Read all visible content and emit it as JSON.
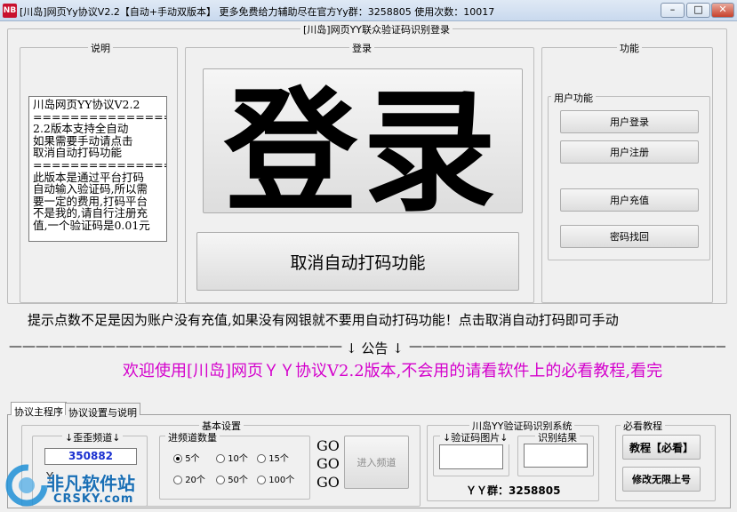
{
  "window": {
    "icon_text": "NB",
    "title": "[川岛]网页Yy协议V2.2【自动+手动双版本】   更多免费给力辅助尽在官方Yy群：3258805   使用次数：10017",
    "min": "–",
    "max": "□",
    "close": "✕"
  },
  "main_group": {
    "label": "[川岛]网页YY联众验证码识别登录"
  },
  "explain": {
    "label": "说明",
    "lines": [
      " 川岛网页YY协议V2.2",
      "======================",
      "2.2版本支持全自动",
      "如果需要手动请点击",
      "取消自动打码功能",
      "======================",
      "此版本是通过平台打码",
      "自动输入验证码,所以需",
      "要一定的费用,打码平台",
      "不是我的,请自行注册充",
      "值,一个验证码是0.01元"
    ]
  },
  "login": {
    "label": "登录",
    "big_button": "登录",
    "cancel_auto": "取消自动打码功能"
  },
  "features": {
    "label": "功能",
    "user_group": "用户功能",
    "buttons": [
      "用户登录",
      "用户注册",
      "用户充值",
      "密码找回"
    ]
  },
  "hint": "提示点数不足是因为账户没有充值,如果没有网银就不要用自动打码功能！点击取消自动打码即可手动",
  "notice": {
    "left": "——————————————————————————",
    "title": "↓ 公告 ↓",
    "right": "——————————————————————————"
  },
  "marquee": "欢迎使用[川岛]网页ＹＹ协议V2.2版本,不会用的请看软件上的必看教程,看完",
  "tabs": [
    "协议主程序",
    "协议设置与说明"
  ],
  "basic": {
    "label": "基本设置",
    "channel_label": "↓歪歪频道↓",
    "channel_value": "350882",
    "yy_label": "Y",
    "count_label": "进频道数量",
    "options": [
      "5个",
      "10个",
      "15个",
      "20个",
      "50个",
      "100个"
    ],
    "selected": "5个",
    "go": [
      "GO",
      "GO",
      "GO"
    ],
    "enter_button": "进入频道"
  },
  "captcha": {
    "label": "川岛YY验证码识别系统",
    "image_label": "↓验证码图片↓",
    "result_label": "识别结果",
    "group_text": "ＹＹ群：3258805"
  },
  "tutorial": {
    "label": "必看教程",
    "tutorial_button": "教程【必看】",
    "modify_button": "修改无限上号"
  },
  "watermark": {
    "cn": "非凡软件站",
    "en": "CRSKY.com"
  }
}
